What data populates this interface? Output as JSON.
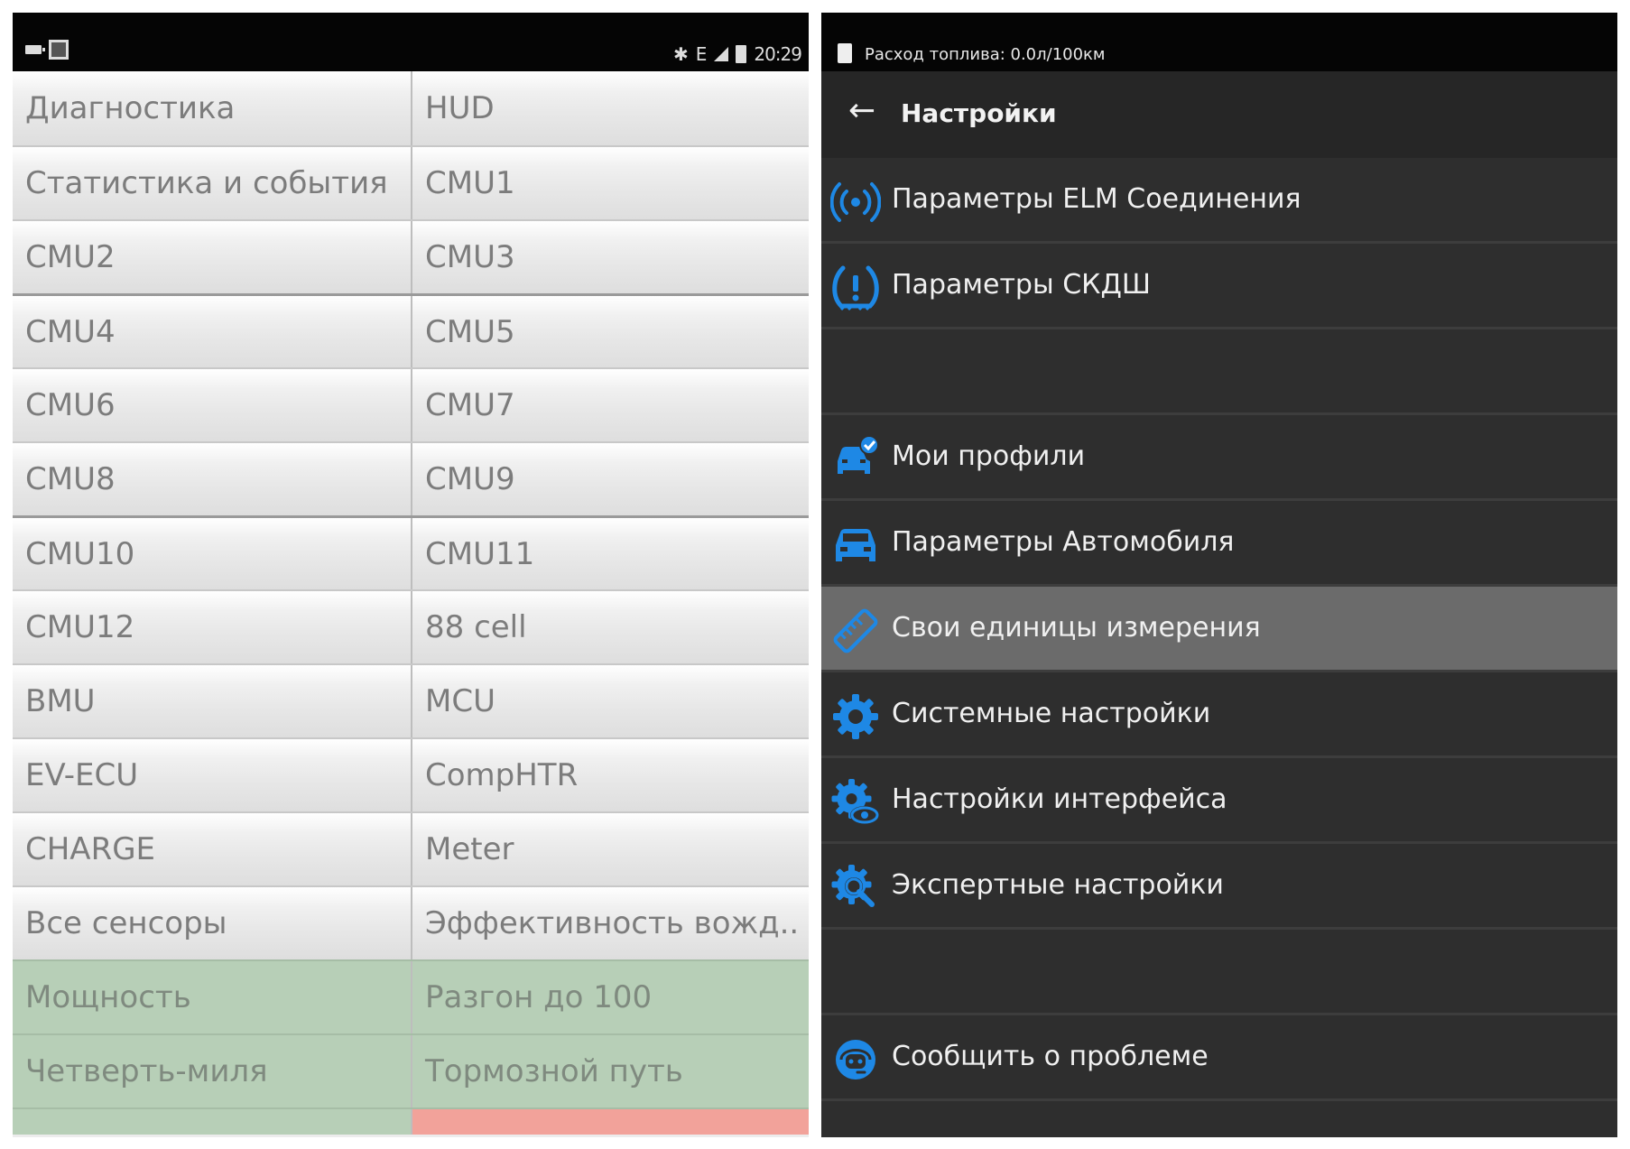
{
  "left_screen": {
    "status_bar": {
      "time": "20:29",
      "network": "E"
    },
    "rows": [
      {
        "left": "Диагностика",
        "right": "HUD"
      },
      {
        "left": "Статистика и события",
        "right": "CMU1"
      },
      {
        "left": "CMU2",
        "right": "CMU3"
      },
      {
        "left": "CMU4",
        "right": "CMU5"
      },
      {
        "left": "CMU6",
        "right": "CMU7"
      },
      {
        "left": "CMU8",
        "right": "CMU9"
      },
      {
        "left": "CMU10",
        "right": "CMU11"
      },
      {
        "left": "CMU12",
        "right": "88 cell"
      },
      {
        "left": "BMU",
        "right": "MCU"
      },
      {
        "left": "EV-ECU",
        "right": "CompHTR"
      },
      {
        "left": "CHARGE",
        "right": "Meter"
      },
      {
        "left": "Все сенсоры",
        "right": "Эффективность вожд.."
      },
      {
        "left": "Мощность",
        "right": "Разгон до 100"
      },
      {
        "left": "Четверть-миля",
        "right": "Тормозной путь"
      }
    ],
    "colors": {
      "normal_bg": "#e7e7e7",
      "green_bg": "#b7cfb7",
      "red_bg": "#f2a29a",
      "text": "#7c7c7c"
    }
  },
  "right_screen": {
    "status_bar": {
      "text": "Расход топлива: 0.0л/100км"
    },
    "toolbar": {
      "back_icon": "arrow-left-icon",
      "title": "Настройки"
    },
    "menu": [
      {
        "label": "Параметры ELM Соединения",
        "icon": "wireless-signal-icon"
      },
      {
        "label": "Параметры СКДШ",
        "icon": "tire-pressure-warning-icon"
      },
      {
        "label": "",
        "icon": ""
      },
      {
        "label": "Мои профили",
        "icon": "car-profile-check-icon"
      },
      {
        "label": "Параметры Автомобиля",
        "icon": "car-icon"
      },
      {
        "label": "Свои единицы измерения",
        "icon": "ruler-icon",
        "highlighted": true
      },
      {
        "label": "Системные настройки",
        "icon": "gear-icon"
      },
      {
        "label": "Настройки интерфейса",
        "icon": "gear-eye-icon"
      },
      {
        "label": "Экспертные настройки",
        "icon": "gear-magnifier-icon"
      },
      {
        "label": "",
        "icon": ""
      },
      {
        "label": "Сообщить о проблеме",
        "icon": "support-agent-icon"
      }
    ],
    "colors": {
      "background": "#2e2e2e",
      "highlight": "#6b6b6b",
      "icon_accent": "#1e88e5"
    }
  }
}
